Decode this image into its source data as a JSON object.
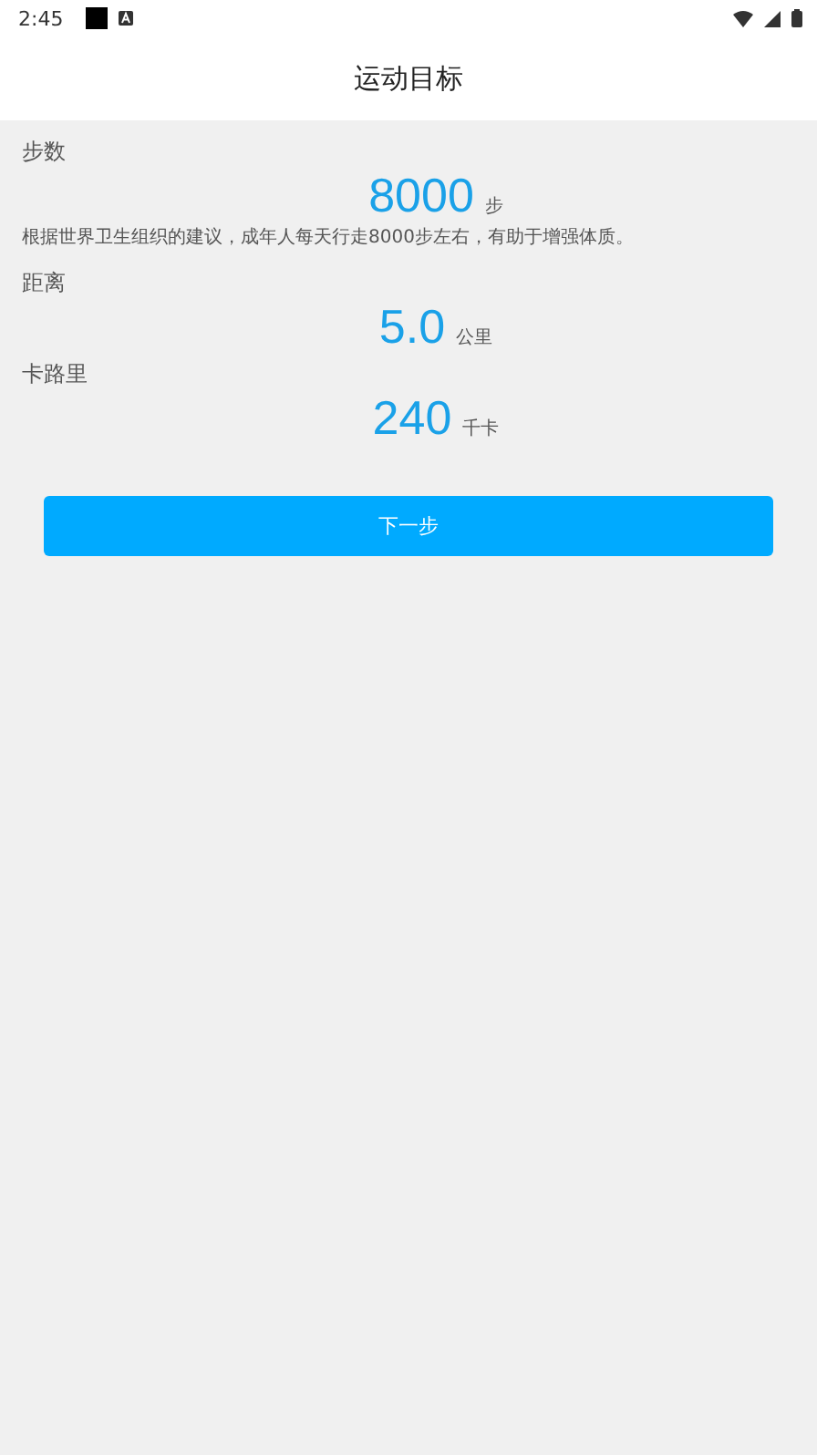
{
  "status_bar": {
    "time": "2:45"
  },
  "header": {
    "title": "运动目标"
  },
  "goals": [
    {
      "label": "步数",
      "value": "8000",
      "unit": "步",
      "note": "根据世界卫生组织的建议，成年人每天行走8000步左右，有助于增强体质。"
    },
    {
      "label": "距离",
      "value": "5.0",
      "unit": "公里"
    },
    {
      "label": "卡路里",
      "value": "240",
      "unit": "千卡"
    }
  ],
  "next_button": {
    "label": "下一步"
  }
}
